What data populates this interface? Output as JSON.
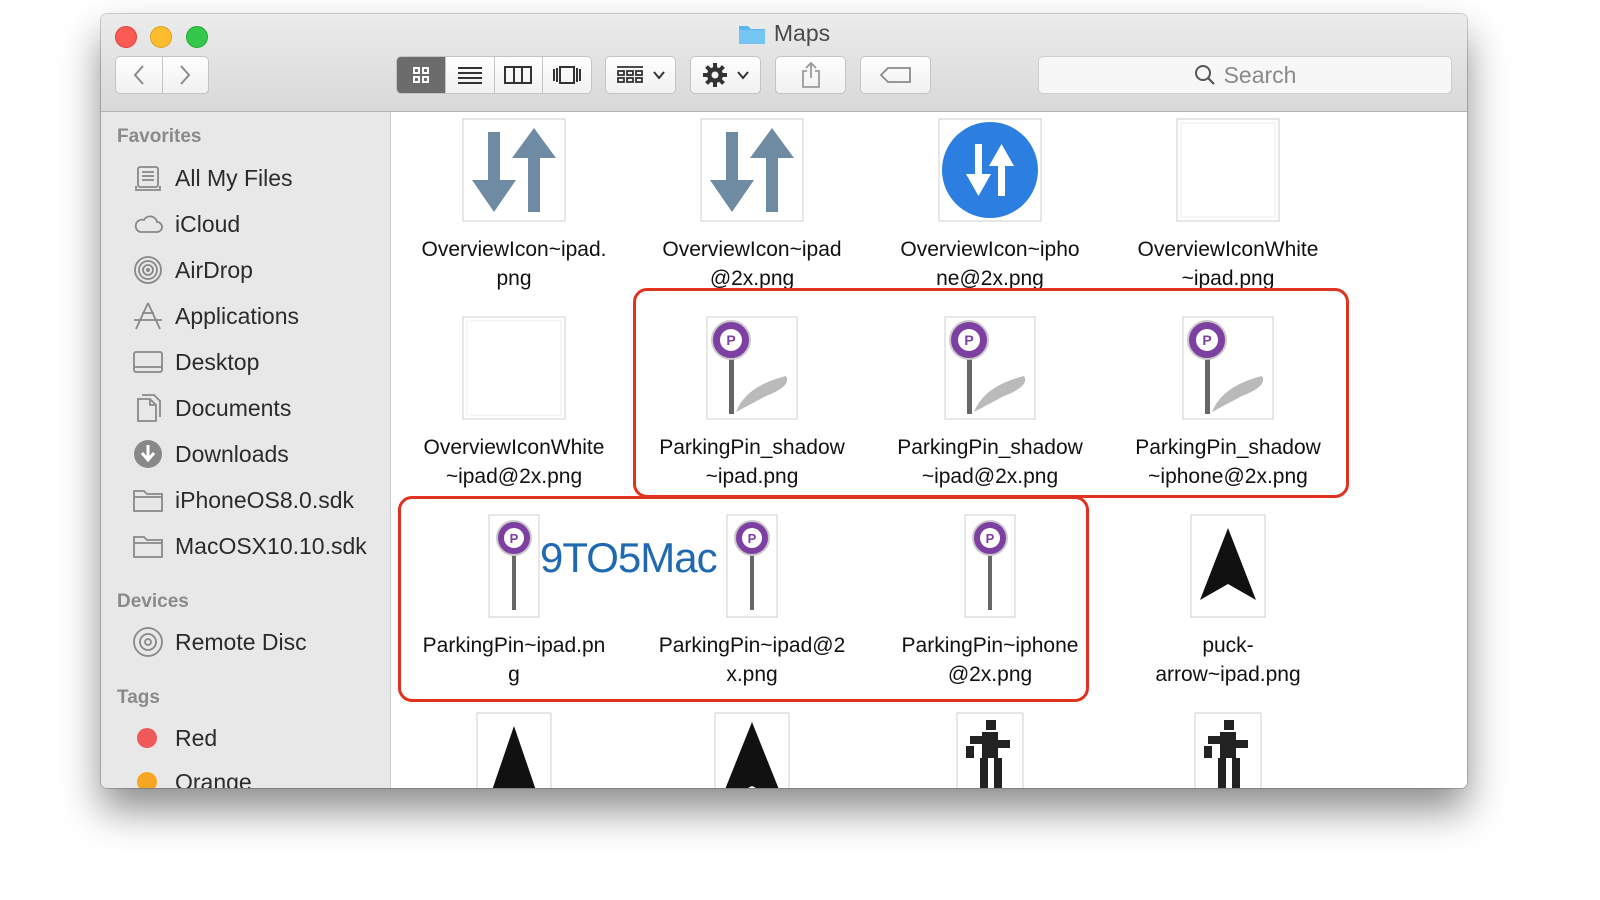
{
  "window": {
    "title": "Maps"
  },
  "toolbar": {
    "search_placeholder": "Search"
  },
  "sidebar": {
    "favorites_header": "Favorites",
    "favorites": [
      {
        "label": "All My Files",
        "icon": "all-files-icon"
      },
      {
        "label": "iCloud",
        "icon": "cloud-icon"
      },
      {
        "label": "AirDrop",
        "icon": "airdrop-icon"
      },
      {
        "label": "Applications",
        "icon": "applications-icon"
      },
      {
        "label": "Desktop",
        "icon": "desktop-icon"
      },
      {
        "label": "Documents",
        "icon": "documents-icon"
      },
      {
        "label": "Downloads",
        "icon": "downloads-icon"
      },
      {
        "label": "iPhoneOS8.0.sdk",
        "icon": "folder-icon"
      },
      {
        "label": "MacOSX10.10.sdk",
        "icon": "folder-icon"
      }
    ],
    "devices_header": "Devices",
    "devices": [
      {
        "label": "Remote Disc",
        "icon": "disc-icon"
      }
    ],
    "tags_header": "Tags",
    "tags": [
      {
        "label": "Red",
        "color": "#f0595a"
      },
      {
        "label": "Orange",
        "color": "#f6a623"
      }
    ]
  },
  "files": {
    "row1": [
      {
        "line1": "OverviewIcon~ipad.",
        "line2": "png",
        "icon": "overview-arrows-icon"
      },
      {
        "line1": "OverviewIcon~ipad",
        "line2": "@2x.png",
        "icon": "overview-arrows-icon"
      },
      {
        "line1": "OverviewIcon~ipho",
        "line2": "ne@2x.png",
        "icon": "overview-blue-circle-icon"
      },
      {
        "line1": "OverviewIconWhite",
        "line2": "~ipad.png",
        "icon": "blank-image-icon"
      }
    ],
    "row2": [
      {
        "line1": "OverviewIconWhite",
        "line2": "~ipad@2x.png",
        "icon": "blank-image-icon"
      },
      {
        "line1": "ParkingPin_shadow",
        "line2": "~ipad.png",
        "icon": "parking-pin-shadow-icon"
      },
      {
        "line1": "ParkingPin_shadow",
        "line2": "~ipad@2x.png",
        "icon": "parking-pin-shadow-icon"
      },
      {
        "line1": "ParkingPin_shadow",
        "line2": "~iphone@2x.png",
        "icon": "parking-pin-shadow-icon"
      }
    ],
    "row3": [
      {
        "line1": "ParkingPin~ipad.pn",
        "line2": "g",
        "icon": "parking-pin-icon"
      },
      {
        "line1": "ParkingPin~ipad@2",
        "line2": "x.png",
        "icon": "parking-pin-icon"
      },
      {
        "line1": "ParkingPin~iphone",
        "line2": "@2x.png",
        "icon": "parking-pin-icon"
      },
      {
        "line1": "puck-",
        "line2": "arrow~ipad.png",
        "icon": "puck-arrow-icon"
      }
    ]
  },
  "watermark": "9TO5Mac"
}
